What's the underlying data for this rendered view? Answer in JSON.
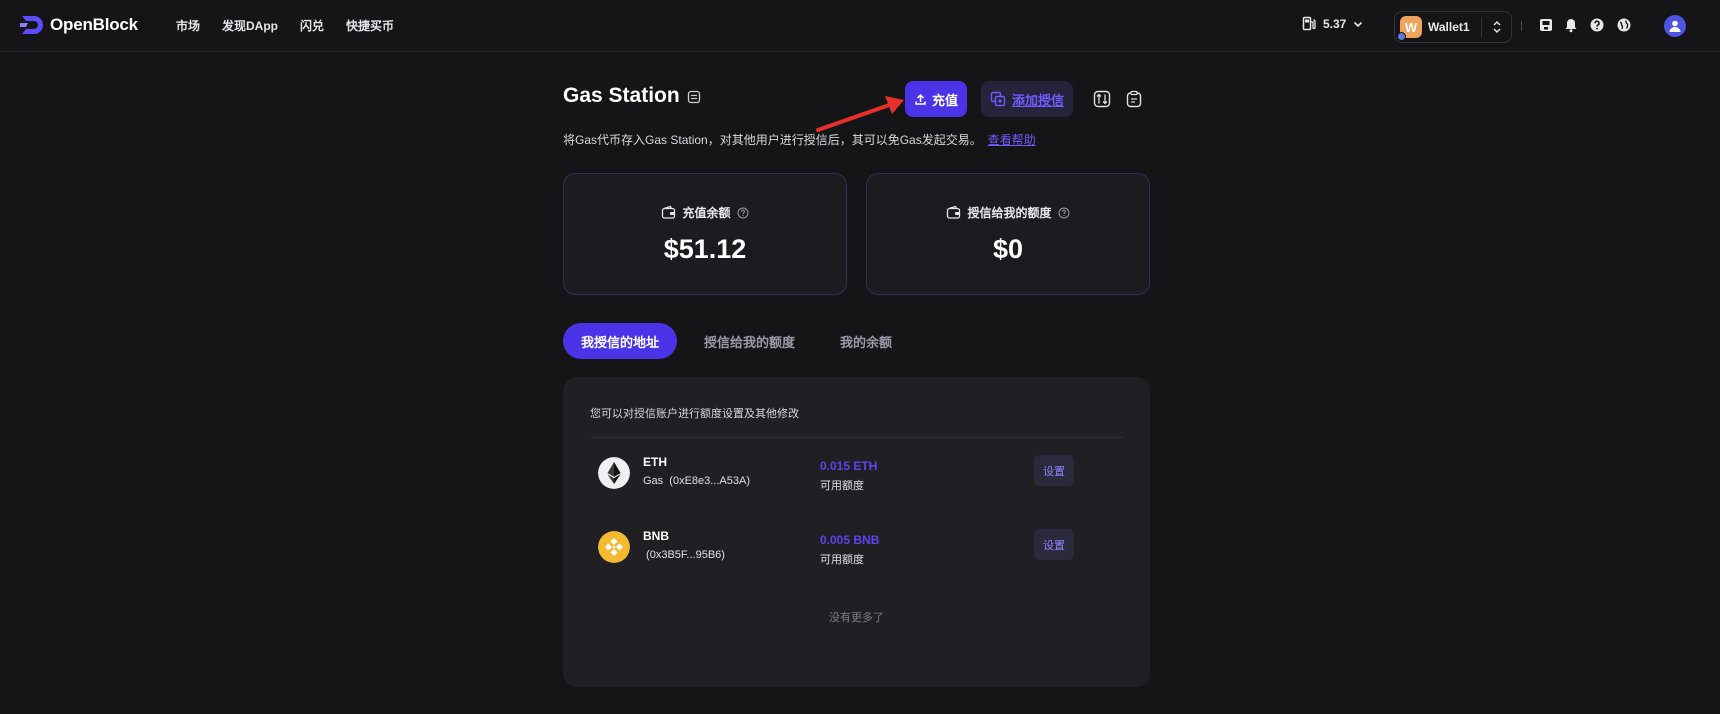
{
  "header": {
    "brand": "OpenBlock",
    "nav": [
      {
        "label": "市场"
      },
      {
        "label": "发现DApp"
      },
      {
        "label": "闪兑"
      },
      {
        "label": "快捷买币"
      }
    ],
    "gas_value": "5.37",
    "wallet": {
      "avatar_letter": "W",
      "name": "Wallet1"
    }
  },
  "page": {
    "title": "Gas Station",
    "recharge_label": "充值",
    "add_auth_label": "添加授信",
    "description": "将Gas代币存入Gas Station，对其他用户进行授信后，其可以免Gas发起交易。",
    "help_link": "查看帮助"
  },
  "stats": [
    {
      "label": "充值余额",
      "value": "$51.12"
    },
    {
      "label": "授信给我的额度",
      "value": "$0"
    }
  ],
  "tabs": [
    {
      "label": "我授信的地址",
      "active": true
    },
    {
      "label": "授信给我的额度",
      "active": false
    },
    {
      "label": "我的余额",
      "active": false
    }
  ],
  "list": {
    "hint": "您可以对授信账户进行额度设置及其他修改",
    "items": [
      {
        "coin": "ETH",
        "address": "Gas  (0xE8e3...A53A)",
        "amount": "0.015 ETH",
        "amount_label": "可用额度",
        "action": "设置",
        "icon": "eth-icon"
      },
      {
        "coin": "BNB",
        "address": " (0x3B5F...95B6)",
        "amount": "0.005 BNB",
        "amount_label": "可用额度",
        "action": "设置",
        "icon": "bnb-icon"
      }
    ],
    "end_text": "没有更多了"
  },
  "colors": {
    "background": "#151517",
    "accent": "#4b33e8",
    "accent_text": "#6f5cff",
    "panel": "#202024",
    "annotation_arrow": "#e8302a"
  }
}
